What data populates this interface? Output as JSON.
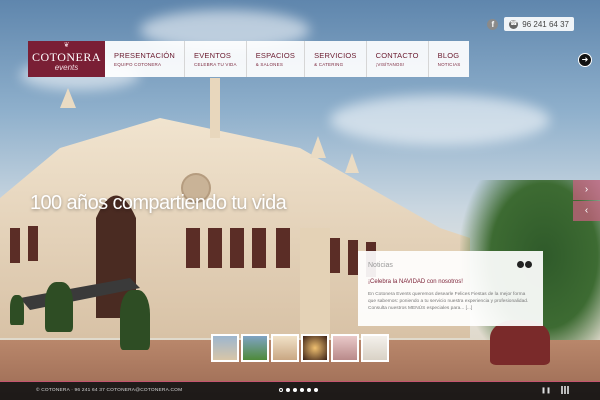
{
  "header": {
    "facebook_icon": "facebook-icon",
    "phone_icon": "phone-icon",
    "phone_number": "96 241 64 37"
  },
  "logo": {
    "mark": "❦",
    "name": "COTONERA",
    "sub": "events"
  },
  "nav": {
    "items": [
      {
        "title": "PRESENTACIÓN",
        "sub": "EQUIPO COTONERA"
      },
      {
        "title": "EVENTOS",
        "sub": "CELEBRA TU VIDA"
      },
      {
        "title": "ESPACIOS",
        "sub": "& SALONES"
      },
      {
        "title": "SERVICIOS",
        "sub": "& CATERING"
      },
      {
        "title": "CONTACTO",
        "sub": "¡VISÍTANOS!"
      },
      {
        "title": "BLOG",
        "sub": "NOTICIAS"
      }
    ]
  },
  "slider": {
    "headline": "100 años compartiendo tu vida",
    "next_icon": "chevron-right-icon",
    "prev_icon": "chevron-left-icon",
    "thumbnail_count": 6
  },
  "news": {
    "label": "Noticias",
    "title": "¡Celebra la NAVIDAD con nosotros!",
    "body": "En Cotonera Events queremos desearle Felices Fiestas de la mejor forma que sabemos: poniendo a tu servicio nuestra experiencia y profesionalidad. Consulta nuestros MENÚS especiales para... [...]"
  },
  "footer": {
    "text": "© COTONERA · 96 241 64 37 COTONERA@COTONERA.COM",
    "pause_icon": "pause-icon",
    "grid_icon": "grid-icon"
  },
  "colors": {
    "brand": "#7a1f35",
    "accent": "#c4546f"
  }
}
